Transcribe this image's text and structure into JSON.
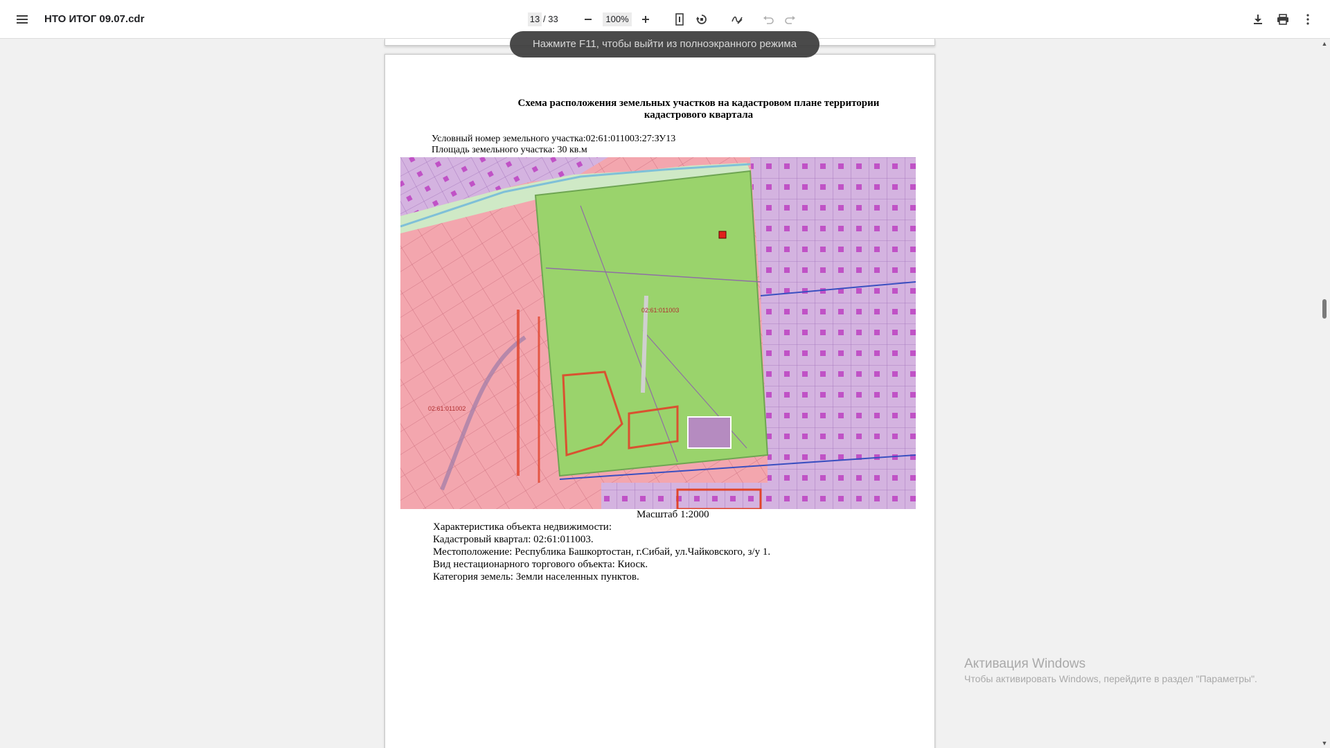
{
  "toolbar": {
    "doc_title": "НТО ИТОГ 09.07.cdr",
    "current_page": "13",
    "page_total": "/ 33",
    "zoom": "100%"
  },
  "toast": "Нажмите F11, чтобы выйти из полноэкранного режима",
  "document": {
    "heading_line1": "Схема расположения земельных участков на кадастровом плане территории",
    "heading_line2": "кадастрового квартала",
    "plot_number": "Условный номер земельного участка:02:61:011003:27:ЗУ13",
    "plot_area": "Площадь земельного участка: 30 кв.м",
    "map_labels": {
      "quarter_main": "02:61:011003",
      "quarter_west": "02:61:011002"
    },
    "scale": "Масштаб 1:2000",
    "info": [
      "Характеристика объекта недвижимости:",
      "Кадастровый квартал: 02:61:011003.",
      "Местоположение: Республика Башкортостан, г.Сибай, ул.Чайковского, з/у 1.",
      "Вид нестационарного торгового объекта: Киоск.",
      "Категория земель: Земли населенных пунктов."
    ]
  },
  "watermark": {
    "title": "Активация Windows",
    "subtitle": "Чтобы активировать Windows, перейдите в раздел \"Параметры\"."
  },
  "icons": [
    "menu-icon",
    "zoom-out-icon",
    "zoom-in-icon",
    "fit-page-icon",
    "rotate-icon",
    "annotate-icon",
    "undo-icon",
    "redo-icon",
    "download-icon",
    "print-icon",
    "more-icon"
  ],
  "colors": {
    "toolbar_bg": "#ffffff",
    "viewer_bg": "#f1f1f1",
    "map_green": "#9ad36c",
    "map_pink": "#f3a6ae",
    "map_purple": "#c9a8d8",
    "kiosk_red": "#e0201b"
  }
}
